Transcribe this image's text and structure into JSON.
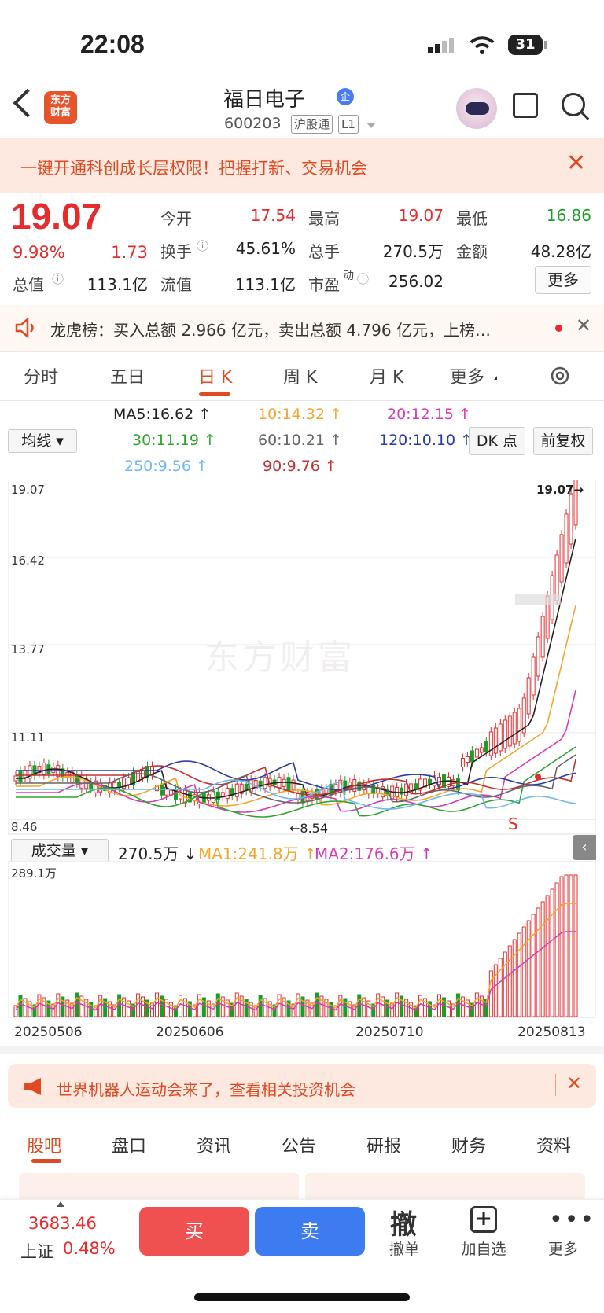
{
  "status": {
    "time": "22:08",
    "battery": "31"
  },
  "header": {
    "logo": "东方\n财富",
    "name": "福日电子",
    "badge": "企",
    "code": "600203",
    "tags": [
      "沪股通",
      "L1"
    ]
  },
  "banner": {
    "text": "一键开通科创成长层权限！把握打新、交易机会"
  },
  "quote": {
    "price": "19.07",
    "pct": "9.98%",
    "change": "1.73",
    "fields": [
      {
        "label": "今开",
        "value": "17.54",
        "color": "#e52b2b"
      },
      {
        "label": "最高",
        "value": "19.07",
        "color": "#e52b2b"
      },
      {
        "label": "最低",
        "value": "16.86",
        "color": "#1a9e2a"
      },
      {
        "label": "换手",
        "value": "45.61%",
        "color": "#222"
      },
      {
        "label": "总手",
        "value": "270.5万",
        "color": "#222"
      },
      {
        "label": "金额",
        "value": "48.28亿",
        "color": "#222"
      },
      {
        "label": "总值",
        "value": "113.1亿",
        "color": "#222"
      },
      {
        "label": "流值",
        "value": "113.1亿",
        "color": "#222"
      },
      {
        "label": "市盈",
        "value": "256.02",
        "color": "#222"
      }
    ],
    "pe_sup": "动",
    "more": "更多"
  },
  "notice": {
    "text": "龙虎榜：买入总额 2.966 亿元，卖出总额 4.796 亿元，上榜…"
  },
  "tabs": [
    "分时",
    "五日",
    "日 K",
    "周 K",
    "月 K",
    "更多"
  ],
  "ma": {
    "selector": "均线",
    "ma5": "MA5:16.62 ↑",
    "ma10": "10:14.32 ↑",
    "ma20": "20:12.15 ↑",
    "ma30": "30:11.19 ↑",
    "ma60": "60:10.21 ↑",
    "ma120": "120:10.10 ↑",
    "ma250": "250:9.56 ↑",
    "ma90": "90:9.76 ↑",
    "dk": "DK 点",
    "fq": "前复权"
  },
  "chart_data": {
    "type": "candlestick",
    "y_ticks": [
      "19.07",
      "16.42",
      "13.77",
      "11.11",
      "8.46"
    ],
    "high_label": "19.07",
    "low_label": "8.54",
    "watermark": "东方财富",
    "markers": [
      "S"
    ],
    "volume": {
      "selector": "成交量",
      "current": "270.5万 ↓",
      "ma1": "MA1:241.8万 ↑",
      "ma2": "MA2:176.6万 ↑",
      "max_label": "289.1万"
    },
    "dates": [
      "20250506",
      "20250606",
      "20250710",
      "20250813"
    ],
    "colors": {
      "up": "#e52b2b",
      "down": "#1a9e2a",
      "ma5": "#222222",
      "ma10": "#f2a62a",
      "ma20": "#d83ab2",
      "ma30": "#2fa52f",
      "ma60": "#666666",
      "ma120": "#2b3aa6",
      "ma250": "#6fb8f0",
      "ma90": "#c23030"
    }
  },
  "promo": {
    "text": "世界机器人运动会来了，查看相关投资机会"
  },
  "bottom_tabs": [
    "股吧",
    "盘口",
    "资讯",
    "公告",
    "研报",
    "财务",
    "资料"
  ],
  "bottom_bar": {
    "index_value": "3683.46",
    "index_name": "上证",
    "index_pct": "0.48%",
    "buy": "买",
    "sell": "卖",
    "cancel_icon": "撤",
    "cancel": "撤单",
    "watch": "加自选",
    "more": "更多"
  }
}
